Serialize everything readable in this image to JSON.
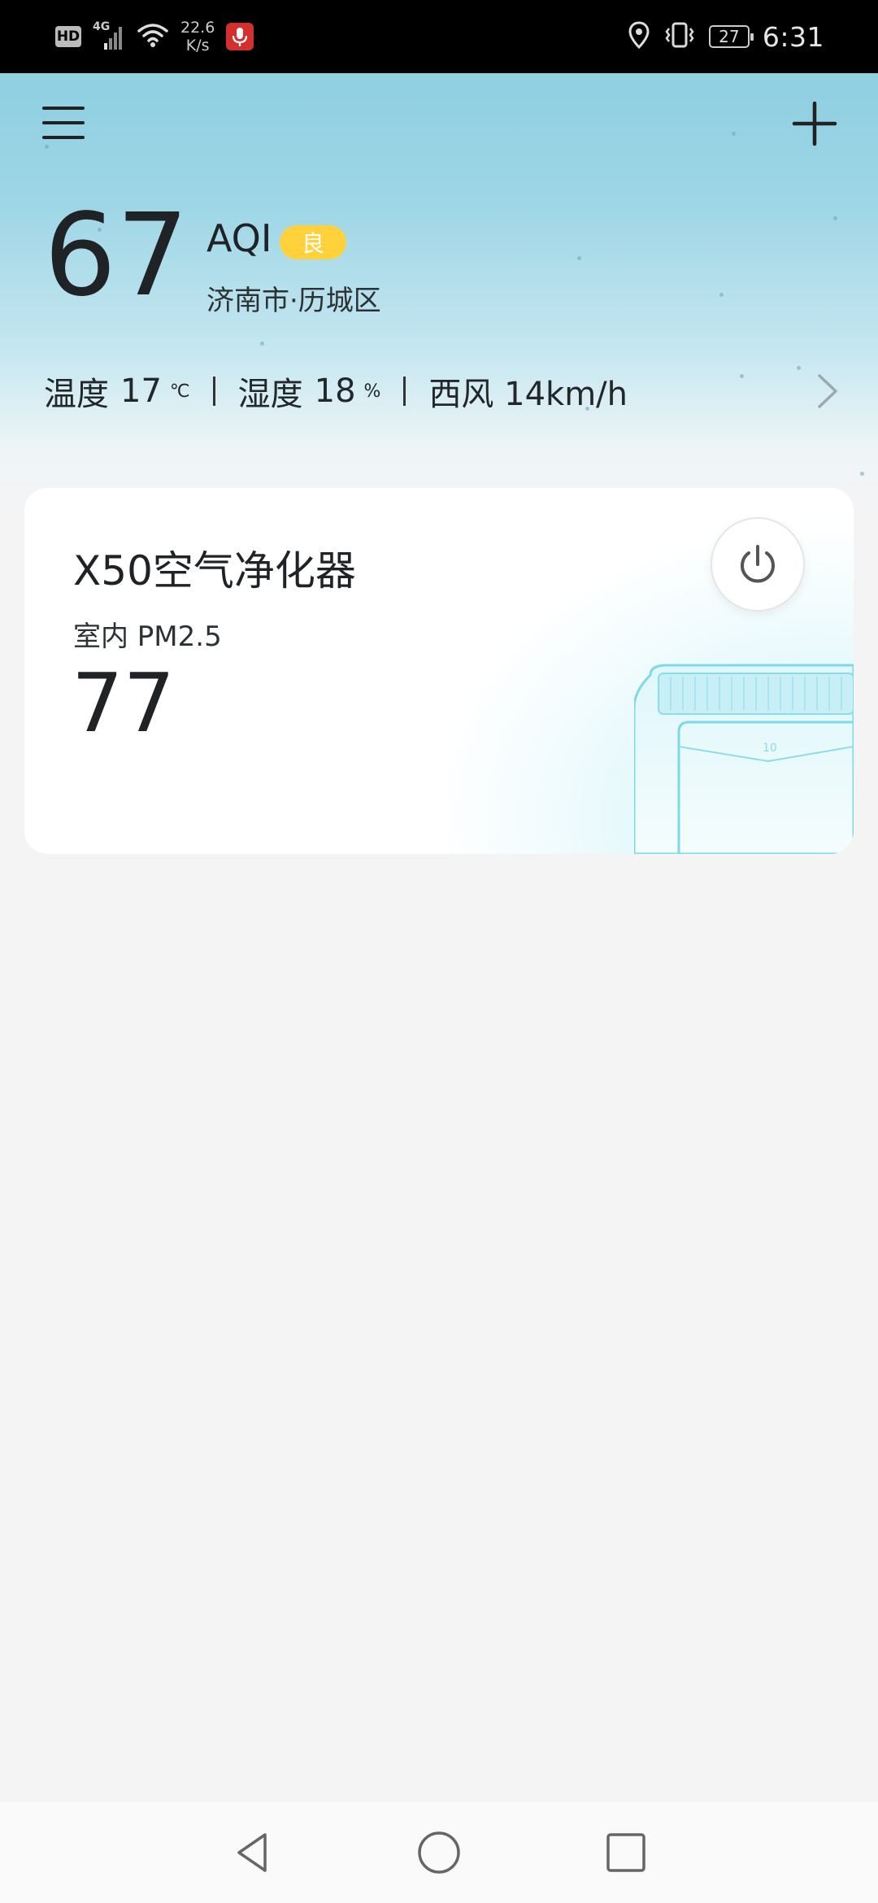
{
  "status_bar": {
    "hd": "HD",
    "network": "4G",
    "speed_value": "22.6",
    "speed_unit": "K/s",
    "battery": "27",
    "time": "6:31",
    "icons": [
      "signal-icon",
      "wifi-icon",
      "mic-icon",
      "location-icon",
      "vibrate-icon",
      "battery-icon"
    ]
  },
  "header": {
    "aqi_value": "67",
    "aqi_label": "AQI",
    "aqi_level": "良",
    "aqi_level_color": "#ffd23c",
    "location": "济南市·历城区",
    "temperature_label": "温度",
    "temperature_value": "17",
    "temperature_unit": "℃",
    "humidity_label": "湿度",
    "humidity_value": "18",
    "humidity_unit": "%",
    "wind": "西风 14km/h",
    "icons": [
      "menu-icon",
      "add-icon",
      "chevron-right-icon"
    ]
  },
  "device_card": {
    "name": "X50空气净化器",
    "pm_label": "室内 PM2.5",
    "pm_value": "77",
    "icons": [
      "power-icon"
    ]
  },
  "nav_bar": {
    "icons": [
      "back-icon",
      "home-icon",
      "recents-icon"
    ]
  }
}
